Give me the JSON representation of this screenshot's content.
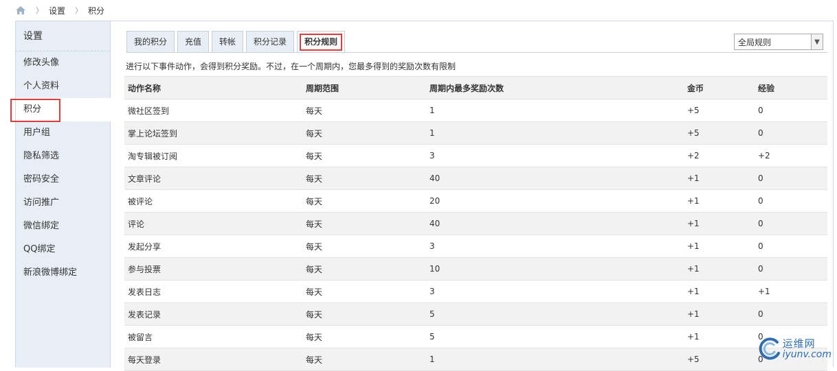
{
  "breadcrumb": {
    "items": [
      "设置",
      "积分"
    ]
  },
  "sidebar": {
    "title": "设置",
    "items": [
      {
        "label": "修改头像"
      },
      {
        "label": "个人资料"
      },
      {
        "label": "积分"
      },
      {
        "label": "用户组"
      },
      {
        "label": "隐私筛选"
      },
      {
        "label": "密码安全"
      },
      {
        "label": "访问推广"
      },
      {
        "label": "微信绑定"
      },
      {
        "label": "QQ绑定"
      },
      {
        "label": "新浪微博绑定"
      }
    ]
  },
  "tabs": [
    {
      "label": "我的积分"
    },
    {
      "label": "充值"
    },
    {
      "label": "转帐"
    },
    {
      "label": "积分记录"
    },
    {
      "label": "积分规则"
    }
  ],
  "select": {
    "value": "全局规则"
  },
  "description": "进行以下事件动作，会得到积分奖励。不过，在一个周期内，您最多得到的奖励次数有限制",
  "table": {
    "headers": [
      "动作名称",
      "周期范围",
      "周期内最多奖励次数",
      "金币",
      "经验"
    ],
    "rows": [
      [
        "微社区签到",
        "每天",
        "1",
        "+5",
        "0"
      ],
      [
        "掌上论坛签到",
        "每天",
        "1",
        "+5",
        "0"
      ],
      [
        "淘专辑被订阅",
        "每天",
        "3",
        "+2",
        "+2"
      ],
      [
        "文章评论",
        "每天",
        "40",
        "+1",
        "0"
      ],
      [
        "被评论",
        "每天",
        "20",
        "+1",
        "0"
      ],
      [
        "评论",
        "每天",
        "40",
        "+1",
        "0"
      ],
      [
        "发起分享",
        "每天",
        "3",
        "+1",
        "0"
      ],
      [
        "参与投票",
        "每天",
        "10",
        "+1",
        "0"
      ],
      [
        "发表日志",
        "每天",
        "3",
        "+1",
        "+1"
      ],
      [
        "发表记录",
        "每天",
        "5",
        "+1",
        "0"
      ],
      [
        "被留言",
        "每天",
        "5",
        "+1",
        "0"
      ],
      [
        "每天登录",
        "每天",
        "1",
        "+5",
        "0"
      ]
    ]
  },
  "watermark": {
    "cn": "运维网",
    "en": "iyunv.com"
  },
  "colors": {
    "sidebar_bg": "#e8eef5",
    "highlight_red": "#e03a3a",
    "row_alt": "#f2f2f2",
    "watermark_blue": "#1a5fa8"
  }
}
